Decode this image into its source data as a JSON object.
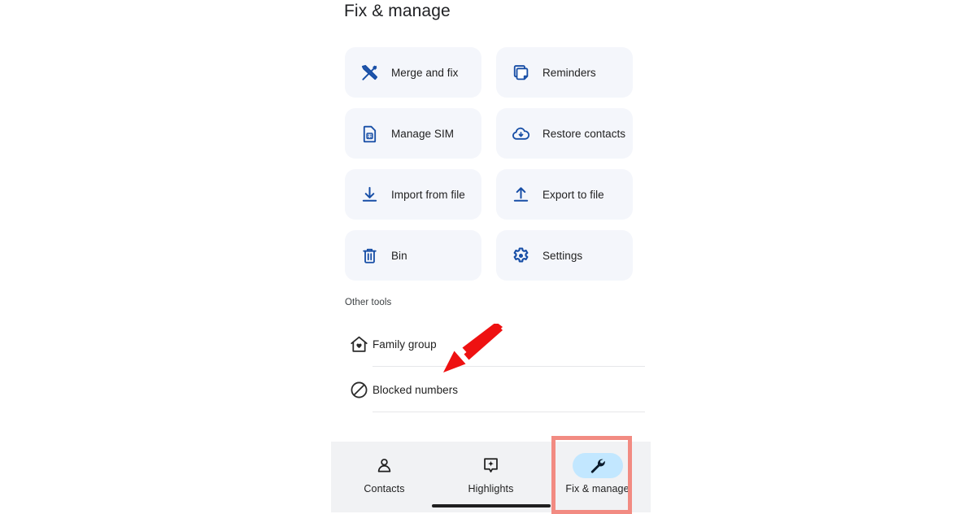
{
  "header": {
    "title": "Fix & manage"
  },
  "tools": {
    "cards": [
      {
        "label": "Merge and fix",
        "icon": "merge-and-fix-icon"
      },
      {
        "label": "Reminders",
        "icon": "reminders-icon"
      },
      {
        "label": "Manage SIM",
        "icon": "sim-card-icon"
      },
      {
        "label": "Restore contacts",
        "icon": "cloud-download-icon"
      },
      {
        "label": "Import from file",
        "icon": "download-icon"
      },
      {
        "label": "Export to file",
        "icon": "upload-icon"
      },
      {
        "label": "Bin",
        "icon": "trash-icon"
      },
      {
        "label": "Settings",
        "icon": "gear-icon"
      }
    ]
  },
  "other_tools": {
    "section_label": "Other tools",
    "items": [
      {
        "label": "Family group",
        "icon": "house-heart-icon"
      },
      {
        "label": "Blocked numbers",
        "icon": "block-slash-icon"
      }
    ]
  },
  "bottom_nav": {
    "items": [
      {
        "label": "Contacts",
        "icon": "person-icon",
        "active": false
      },
      {
        "label": "Highlights",
        "icon": "sparkle-icon",
        "active": false
      },
      {
        "label": "Fix & manage",
        "icon": "wrench-icon",
        "active": true
      }
    ]
  },
  "colors": {
    "icon_blue": "#174ea6",
    "card_bg": "#f4f6fb",
    "nav_bg": "#f1f2f4",
    "active_pill": "#c2e7ff",
    "annotation_red": "#ee1111",
    "annotation_box": "#f28b82",
    "text_primary": "#1f1f1f"
  }
}
